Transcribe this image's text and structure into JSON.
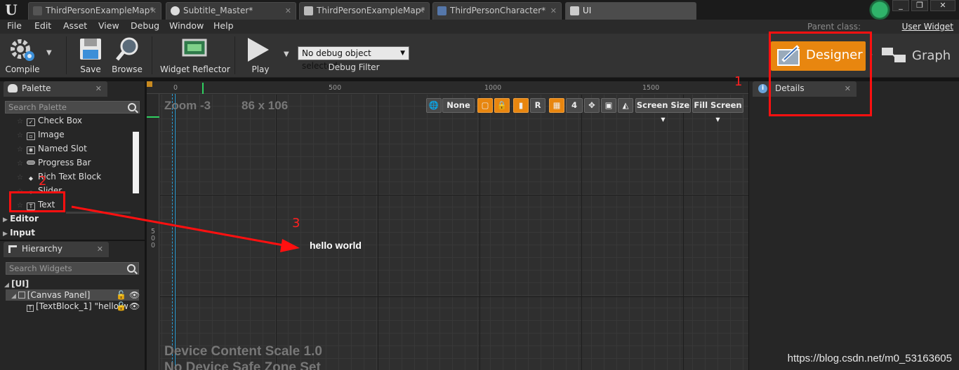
{
  "tabs": [
    {
      "label": "ThirdPersonExampleMap*",
      "active": false
    },
    {
      "label": "Subtitle_Master*",
      "active": false
    },
    {
      "label": "ThirdPersonExampleMap*",
      "active": false
    },
    {
      "label": "ThirdPersonCharacter*",
      "active": false
    },
    {
      "label": "UI",
      "active": true
    }
  ],
  "window_controls": {
    "minimize": "_",
    "restore": "❐",
    "close": "✕"
  },
  "menu": [
    "File",
    "Edit",
    "Asset",
    "View",
    "Debug",
    "Window",
    "Help"
  ],
  "parent_class": {
    "label": "Parent class:",
    "value": "User Widget"
  },
  "toolbar": {
    "compile": "Compile",
    "save": "Save",
    "browse": "Browse",
    "widget_reflector": "Widget Reflector",
    "play": "Play",
    "debug_object": "No debug object selected",
    "debug_filter": "Debug Filter",
    "designer": "Designer",
    "graph": "Graph"
  },
  "palette": {
    "title": "Palette",
    "search_placeholder": "Search Palette",
    "items": [
      {
        "label": "Check Box",
        "icon": "checkbox-icon"
      },
      {
        "label": "Image",
        "icon": "image-icon"
      },
      {
        "label": "Named Slot",
        "icon": "named-slot-icon"
      },
      {
        "label": "Progress Bar",
        "icon": "progress-bar-icon"
      },
      {
        "label": "Rich Text Block",
        "icon": "rich-text-icon"
      },
      {
        "label": "Slider",
        "icon": "slider-icon"
      },
      {
        "label": "Text",
        "icon": "text-icon"
      }
    ],
    "categories": [
      "Editor",
      "Input"
    ]
  },
  "hierarchy": {
    "title": "Hierarchy",
    "search_placeholder": "Search Widgets",
    "root": "[UI]",
    "canvas_panel": "[Canvas Panel]",
    "text_block": "[TextBlock_1] \"hello w"
  },
  "designer_view": {
    "zoom_label": "Zoom -3",
    "size_label": "86 x 106",
    "ruler_marks": [
      "0",
      "500",
      "1000",
      "1500"
    ],
    "ruler_left": "500",
    "none_label": "None",
    "r_label": "R",
    "grid_snap": "4",
    "screen_size": "Screen Size",
    "fill_screen": "Fill Screen",
    "widget_text": "hello world",
    "device_scale": "Device Content Scale 1.0",
    "safe_zone": "No Device Safe Zone Set"
  },
  "details": {
    "title": "Details"
  },
  "annotations": {
    "one": "1",
    "two": "2",
    "three": "3"
  },
  "watermark": "https://blog.csdn.net/m0_53163605",
  "colors": {
    "accent_orange": "#e8860f",
    "annotation_red": "#ff1010",
    "background": "#151515"
  }
}
